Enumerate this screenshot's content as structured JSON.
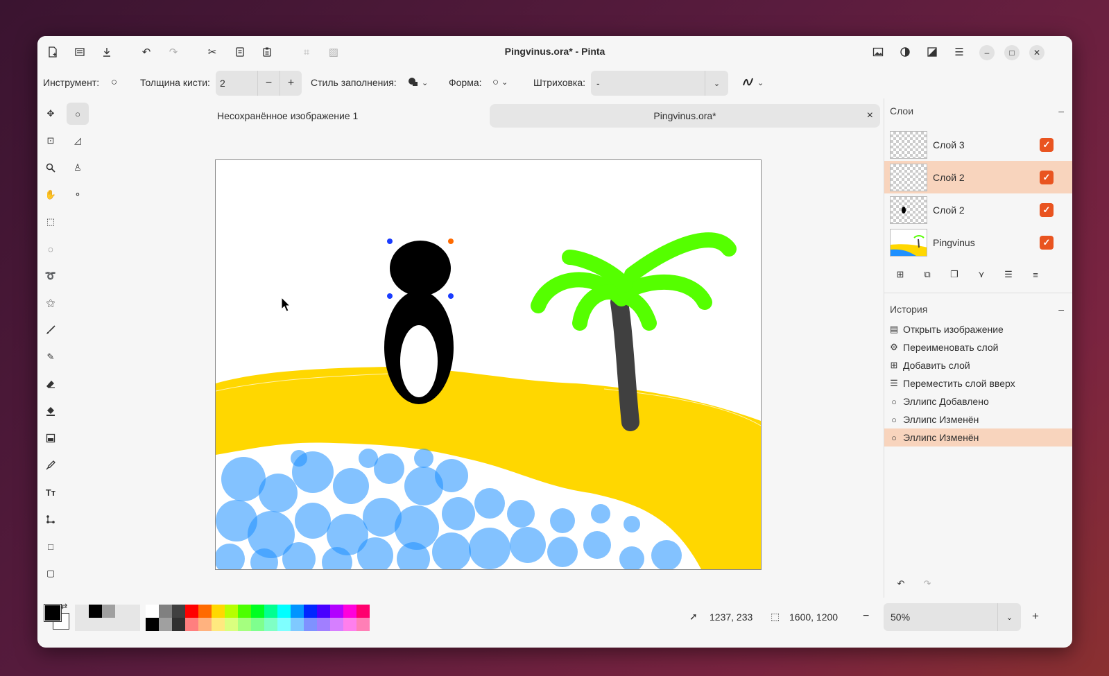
{
  "window": {
    "title": "Pingvinus.ora* - Pinta"
  },
  "headerbar": {
    "left_icons": [
      "new-file-icon",
      "open-file-icon",
      "save-icon",
      "undo-icon",
      "redo-icon",
      "cut-icon",
      "copy-icon",
      "paste-icon",
      "crop-icon",
      "deselect-icon"
    ],
    "right_icons": [
      "image-menu-icon",
      "adjustments-icon",
      "effects-icon",
      "main-menu-icon"
    ],
    "controls": {
      "minimize": "–",
      "maximize": "□",
      "close": "✕"
    }
  },
  "toolbar": {
    "tool_label": "Инструмент:",
    "brush_width_label": "Толщина кисти:",
    "brush_width_value": "2",
    "minus": "−",
    "plus": "+",
    "fill_style_label": "Стиль заполнения:",
    "shape_label": "Форма:",
    "dash_label": "Штриховка:",
    "dash_value": "-"
  },
  "tabs": [
    {
      "label": "Несохранённое изображение 1",
      "active": false
    },
    {
      "label": "Pingvinus.ora*",
      "active": true,
      "close": "×"
    }
  ],
  "layers": {
    "title": "Слои",
    "collapse": "–",
    "items": [
      {
        "name": "Слой 3",
        "visible": true,
        "selected": false
      },
      {
        "name": "Слой 2",
        "visible": true,
        "selected": true
      },
      {
        "name": "Слой 2",
        "visible": true,
        "selected": false
      },
      {
        "name": "Pingvinus",
        "visible": true,
        "selected": false
      }
    ],
    "check": "✓",
    "buttons": [
      "add-layer-icon",
      "duplicate-layer-icon",
      "copy-layer-icon",
      "merge-layer-icon",
      "move-up-icon",
      "properties-icon"
    ]
  },
  "history": {
    "title": "История",
    "collapse": "–",
    "items": [
      {
        "icon": "open-image-icon",
        "glyph": "▤",
        "label": "Открыть изображение",
        "selected": false
      },
      {
        "icon": "rename-layer-icon",
        "glyph": "⚙",
        "label": "Переименовать слой",
        "selected": false
      },
      {
        "icon": "add-layer-icon",
        "glyph": "⊞",
        "label": "Добавить слой",
        "selected": false
      },
      {
        "icon": "move-layer-up-icon",
        "glyph": "☰",
        "label": "Переместить слой вверх",
        "selected": false
      },
      {
        "icon": "ellipse-icon",
        "glyph": "○",
        "label": "Эллипс Добавлено",
        "selected": false
      },
      {
        "icon": "ellipse-icon",
        "glyph": "○",
        "label": "Эллипс Изменён",
        "selected": false
      },
      {
        "icon": "ellipse-icon",
        "glyph": "○",
        "label": "Эллипс Изменён",
        "selected": true
      }
    ],
    "undo": "↶",
    "redo": "↷"
  },
  "status": {
    "cursor_position": "1237, 233",
    "image_size": "1600, 1200",
    "zoom": "50%",
    "zoom_minus": "−",
    "zoom_plus": "+"
  },
  "palette": {
    "primary": "#000000",
    "secondary": "#ffffff",
    "row1": [
      "#ffffff",
      "#808080",
      "#404040",
      "#ff0000",
      "#ff6a00",
      "#ffd800",
      "#b6ff00",
      "#4cff00",
      "#00ff21",
      "#00ff90",
      "#00ffff",
      "#0094ff",
      "#0026ff",
      "#4800ff",
      "#b200ff",
      "#ff00dc",
      "#ff006e"
    ],
    "row2": [
      "#000000",
      "#a0a0a0",
      "#303030",
      "#ff7f7f",
      "#ffb27f",
      "#ffe97f",
      "#daff7f",
      "#a5ff7f",
      "#7fff8e",
      "#7fffc5",
      "#7fffff",
      "#7fc9ff",
      "#7f92ff",
      "#a17fff",
      "#d67fff",
      "#ff7fed",
      "#ff7fb6"
    ],
    "recent": [
      "#000000",
      "#a0a0a0"
    ]
  },
  "colors": {
    "accent": "#e95420",
    "selection": "#f8d4bd",
    "sand": "#ffd700",
    "sea": "#1e90ff",
    "palm_leaves": "#55ff00",
    "palm_trunk": "#404040"
  }
}
